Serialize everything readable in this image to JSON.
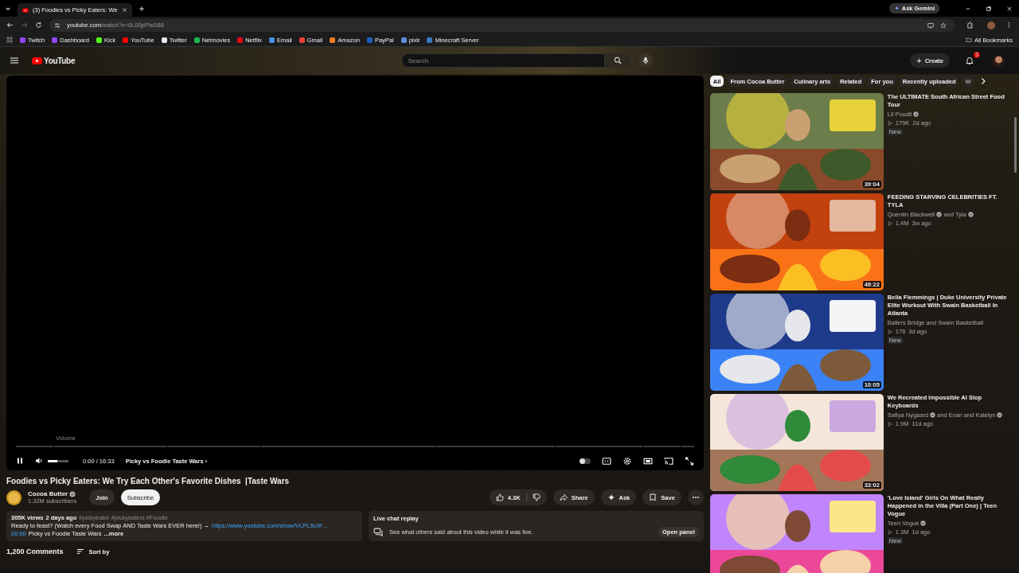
{
  "browser": {
    "tab_title": "(3) Foodies vs Picky Eaters: We",
    "url_domain": "youtube.com",
    "url_path": "/watch?v=0L00pPIsS88",
    "ask_gemini_icon": "✦",
    "ask_gemini": "Ask Gemini",
    "bookmarks": [
      {
        "label": "Twitch",
        "color": "#9146ff"
      },
      {
        "label": "Dashboard",
        "color": "#9146ff"
      },
      {
        "label": "Kick",
        "color": "#53fc18"
      },
      {
        "label": "YouTube",
        "color": "#ff0000"
      },
      {
        "label": "Twitter",
        "color": "#e7e9ea"
      },
      {
        "label": "Netmovies",
        "color": "#1db954"
      },
      {
        "label": "Netflix",
        "color": "#e50914"
      },
      {
        "label": "Email",
        "color": "#4a90e2"
      },
      {
        "label": "Gmail",
        "color": "#ea4335"
      },
      {
        "label": "Amazon",
        "color": "#f47b20"
      },
      {
        "label": "PayPal",
        "color": "#1f5fbf"
      },
      {
        "label": "pixlr",
        "color": "#5d8fd8"
      },
      {
        "label": "Minecraft Server",
        "color": "#3a78c2"
      }
    ],
    "all_bookmarks": "All Bookmarks"
  },
  "header": {
    "logo": "YouTube",
    "search_placeholder": "Search",
    "create_icon": "+",
    "create": "Create",
    "notifications": "3"
  },
  "player": {
    "playing": true,
    "volume_tooltip": "Volume",
    "volume": {
      "level": 0.45
    },
    "time": "0:00 / 16:33",
    "chapter": "Picky vs Foodie Taste Wars",
    "chapter_arrow": "›",
    "autoplay": {
      "on": false
    }
  },
  "video": {
    "title": "Foodies vs Picky Eaters: We Try Each Other's Favorite Dishes  |Taste Wars",
    "channel": "Cocoa Butter",
    "verified": true,
    "subscribers": "1.32M subscribers",
    "join": "Join",
    "subscribe": "Subscribe",
    "likes": "4.3K",
    "share": "Share",
    "ask": "Ask",
    "save": "Save"
  },
  "description": {
    "views": "305K views",
    "age": "2 days ago",
    "tags": "#pickyeater #pickyeaters #Foodie",
    "text": "Ready to feast? (Watch every Food Swap AND Taste Wars EVER here!) →",
    "link": "https://www.youtube.com/show/VLPL5UIF...",
    "timestamp": "00:00",
    "chapter": "Picky vs Foodie Taste Wars",
    "more": "...more"
  },
  "live_chat": {
    "title": "Live chat replay",
    "text": "See what others said about this video while it was live.",
    "button": "Open panel"
  },
  "comments": {
    "count": "1,200 Comments",
    "sort": "Sort by"
  },
  "chips": [
    {
      "label": "All",
      "selected": true
    },
    {
      "label": "From Cocoa Butter",
      "selected": false
    },
    {
      "label": "Culinary arts",
      "selected": false
    },
    {
      "label": "Related",
      "selected": false
    },
    {
      "label": "For you",
      "selected": false
    },
    {
      "label": "Recently uploaded",
      "selected": false
    },
    {
      "label": "W",
      "selected": false
    }
  ],
  "recommendations": [
    {
      "title": "The ULTIMATE South African Street Food Tour",
      "byline": [
        {
          "text": "Lil Poudii",
          "verified": true
        }
      ],
      "views": "179K",
      "age": "2d ago",
      "badge": "New",
      "duration": "39:04"
    },
    {
      "title": "FEEDING STARVING CELEBRITIES FT. TYLA",
      "byline": [
        {
          "text": "Quentin Blackwell",
          "verified": true
        },
        {
          "text": "and Tyla",
          "verified": true
        }
      ],
      "views": "1.4M",
      "age": "3w ago",
      "duration": "49:22"
    },
    {
      "title": "Bella Flemmings | Duke University Private Elite Workout With Swain Basketball In  Atlanta",
      "byline": [
        {
          "text": "Ballers Bridge and Swain Basketball"
        }
      ],
      "views": "176",
      "age": "3d ago",
      "badge": "New",
      "duration": "10:05"
    },
    {
      "title": "We Recreated Impossible AI Slop Keyboards",
      "byline": [
        {
          "text": "Safiya Nygaard",
          "verified": true
        },
        {
          "text": "and Evan and Katelyn",
          "verified": true
        }
      ],
      "views": "1.9M",
      "age": "11d ago",
      "duration": "33:02"
    },
    {
      "title": "'Love Island' Girls On What Really Happened in the Villa (Part One) | Teen Vogue",
      "byline": [
        {
          "text": "Teen Vogue",
          "verified": true
        }
      ],
      "views": "1.3M",
      "age": "1d ago",
      "badge": "New"
    }
  ]
}
